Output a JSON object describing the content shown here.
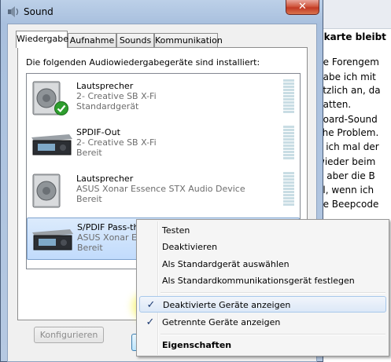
{
  "window": {
    "title": "Sound",
    "close_glyph": "✕"
  },
  "tabs": [
    {
      "label": "Wiedergabe",
      "active": true
    },
    {
      "label": "Aufnahme",
      "active": false
    },
    {
      "label": "Sounds",
      "active": false
    },
    {
      "label": "Kommunikation",
      "active": false
    }
  ],
  "panel": {
    "intro": "Die folgenden Audiowiedergabegeräte sind installiert:",
    "devices": [
      {
        "name": "Lautsprecher",
        "desc": "2- Creative SB X-Fi",
        "status": "Standardgerät",
        "icon": "speaker-icon",
        "default": true,
        "selected": false
      },
      {
        "name": "SPDIF-Out",
        "desc": "2- Creative SB X-Fi",
        "status": "Bereit",
        "icon": "digital-receiver-icon",
        "default": false,
        "selected": false
      },
      {
        "name": "Lautsprecher",
        "desc": "ASUS Xonar Essence STX Audio Device",
        "status": "Bereit",
        "icon": "speaker-icon",
        "default": false,
        "selected": false
      },
      {
        "name": "S/PDIF Pass-through Device",
        "desc": "ASUS Xonar Ess",
        "status": "Bereit",
        "icon": "digital-receiver-icon",
        "default": false,
        "selected": true
      }
    ],
    "configure_label": "Konfigurieren"
  },
  "context_menu": {
    "items": [
      {
        "label": "Testen"
      },
      {
        "label": "Deaktivieren"
      },
      {
        "label": "Als Standardgerät auswählen"
      },
      {
        "label": "Als Standardkommunikationsgerät festlegen"
      },
      {
        "label": "Deaktivierte Geräte anzeigen",
        "checked": true
      },
      {
        "label": "Getrennte Geräte anzeigen",
        "checked": true
      },
      {
        "label": "Eigenschaften",
        "bold": true
      }
    ],
    "check_glyph": "✓"
  },
  "background_text": {
    "title": "dkarte bleibt",
    "lines": [
      "be Forengem",
      "habe ich mit",
      "ötzlich an, da",
      "hatten.",
      "board-Sound",
      "che Problem.",
      "e ich mal der",
      "wieder beim",
      "), aber die B",
      "al, wenn ich",
      "ne Beepcode"
    ]
  },
  "colors": {
    "highlight": "#f5f028",
    "checkmark": "#1c3a72",
    "default_badge": "#2e9e2e"
  }
}
